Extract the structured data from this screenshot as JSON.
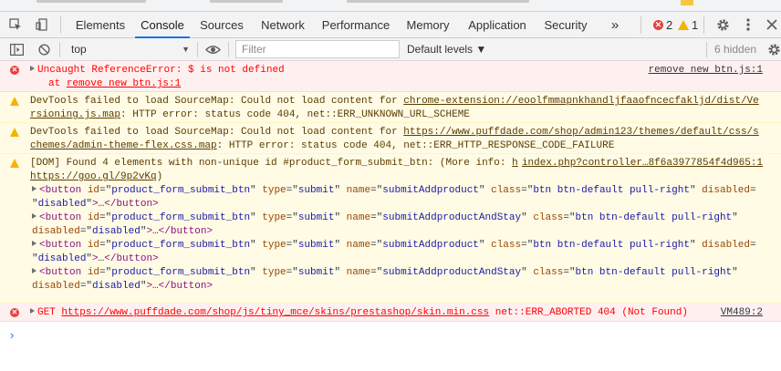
{
  "tabs": [
    {
      "label": "Elements"
    },
    {
      "label": "Console",
      "active": true
    },
    {
      "label": "Sources"
    },
    {
      "label": "Network"
    },
    {
      "label": "Performance"
    },
    {
      "label": "Memory"
    },
    {
      "label": "Application"
    },
    {
      "label": "Security"
    }
  ],
  "more_tabs": "»",
  "counters": {
    "errors": "2",
    "warnings": "1"
  },
  "toolbar": {
    "context": "top",
    "filter_placeholder": "Filter",
    "levels": "Default levels ▼",
    "hidden": "6 hidden"
  },
  "messages": {
    "m1": {
      "text": "Uncaught ReferenceError: $ is not defined",
      "at_prefix": "at",
      "at_link": "remove new btn.js:1",
      "source": "remove new btn.js:1"
    },
    "m2": {
      "prefix": "DevTools failed to load SourceMap: Could not load content for",
      "url": "chrome-extension://eoolfmmapnkhandljfaaofncecfakljd/dist/Versioning.js.map",
      "suffix": ": HTTP error: status code 404, net::ERR_UNKNOWN_URL_SCHEME"
    },
    "m3": {
      "prefix": "DevTools failed to load SourceMap: Could not load content for",
      "url": "https://www.puffdade.com/shop/admin123/themes/default/css/schemes/admin-theme-flex.css.map",
      "suffix": ": HTTP error: status code 404, net::ERR_HTTP_RESPONSE_CODE_FAILURE"
    },
    "m4": {
      "text": "[DOM] Found 4 elements with non-unique id #product_form_submit_btn: (More info:",
      "info_link": "h",
      "goo": "https://goo.gl/9p2vKq",
      "goo_suffix": ")",
      "source": "index.php?controller…8f6a3977854f4d965:1",
      "nodes": [
        {
          "id": "product_form_submit_btn",
          "type": "submit",
          "name": "submitAddproduct",
          "class": "btn btn-default pull-right",
          "disabled": "disabled"
        },
        {
          "id": "product_form_submit_btn",
          "type": "submit",
          "name": "submitAddproductAndStay",
          "class": "btn btn-default pull-right",
          "disabled": "disabled"
        },
        {
          "id": "product_form_submit_btn",
          "type": "submit",
          "name": "submitAddproduct",
          "class": "btn btn-default pull-right",
          "disabled": "disabled"
        },
        {
          "id": "product_form_submit_btn",
          "type": "submit",
          "name": "submitAddproductAndStay",
          "class": "btn btn-default pull-right",
          "disabled": "disabled"
        }
      ]
    },
    "m5": {
      "method": "GET",
      "url": "https://www.puffdade.com/shop/js/tiny_mce/skins/prestashop/skin.min.css",
      "status": "net::ERR_ABORTED 404 (Not Found)",
      "source": "VM489:2"
    }
  },
  "prompt": "›"
}
